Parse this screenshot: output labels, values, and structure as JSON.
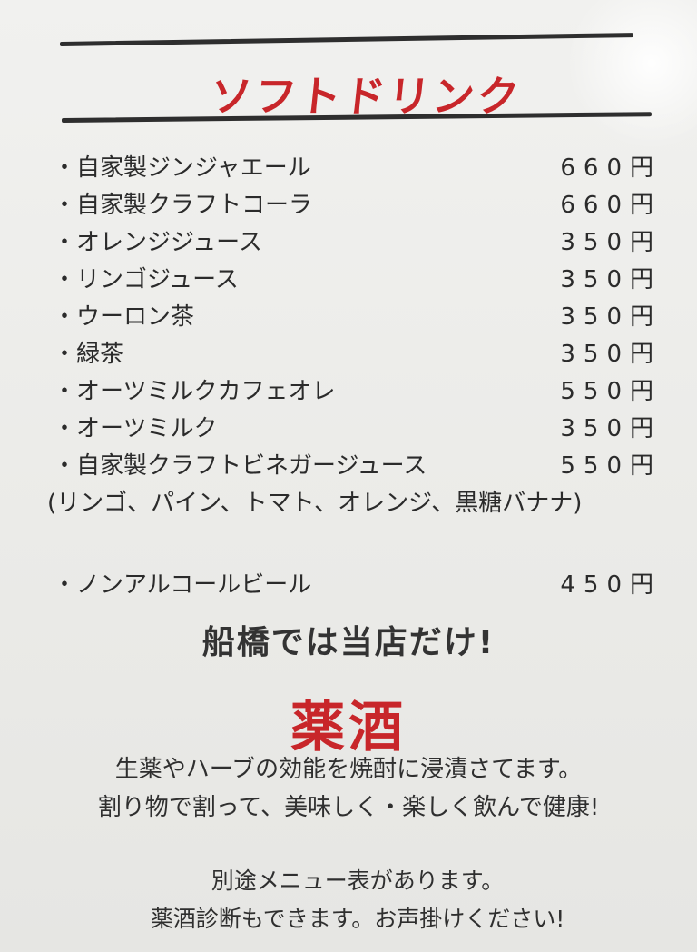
{
  "section_title": "ソフトドリンク",
  "items": [
    {
      "name": "・自家製ジンジャエール",
      "price": "660円"
    },
    {
      "name": "・自家製クラフトコーラ",
      "price": "660円"
    },
    {
      "name": "・オレンジジュース",
      "price": "350円"
    },
    {
      "name": "・リンゴジュース",
      "price": "350円"
    },
    {
      "name": "・ウーロン茶",
      "price": "350円"
    },
    {
      "name": "・緑茶",
      "price": "350円"
    },
    {
      "name": "・オーツミルクカフェオレ",
      "price": "550円"
    },
    {
      "name": "・オーツミルク",
      "price": "350円"
    },
    {
      "name": "・自家製クラフトビネガージュース",
      "price": "550円"
    }
  ],
  "vinegar_note": "(リンゴ、パイン、トマト、オレンジ、黒糖バナナ)",
  "extra_item": {
    "name": "・ノンアルコールビール",
    "price": "450円"
  },
  "headline": "船橋では当店だけ!",
  "red_title": "薬酒",
  "description": [
    "生薬やハーブの効能を焼酎に浸漬さてます。",
    "割り物で割って、美味しく・楽しく飲んで健康!"
  ],
  "footer": [
    "別途メニュー表があります。",
    "薬酒診断もできます。お声掛けください!"
  ],
  "colors": {
    "accent_red": "#c8262a",
    "rule": "#2e2e2e"
  }
}
